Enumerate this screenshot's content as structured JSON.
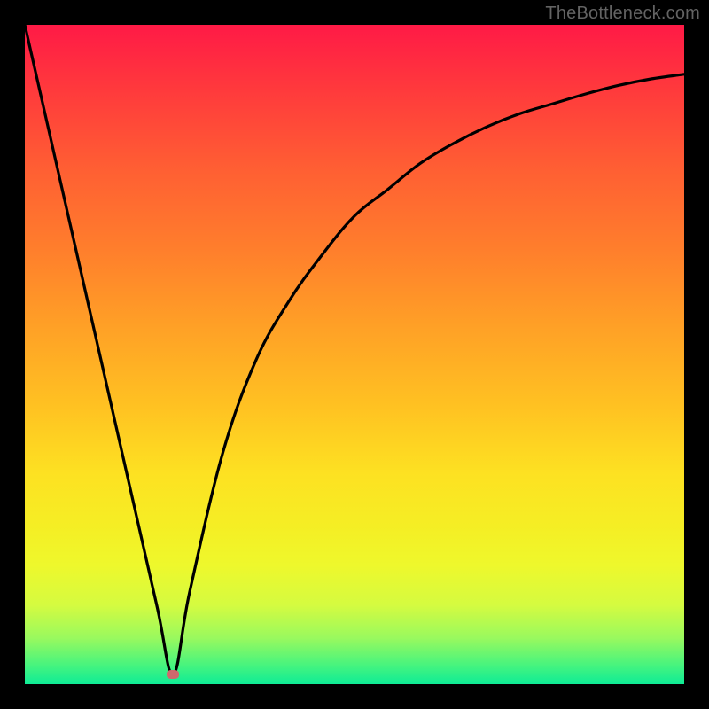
{
  "attribution": "TheBottleneck.com",
  "chart_data": {
    "type": "line",
    "title": "",
    "xlabel": "",
    "ylabel": "",
    "xlim": [
      0,
      100
    ],
    "ylim": [
      0,
      100
    ],
    "grid": false,
    "legend": false,
    "series": [
      {
        "name": "bottleneck-curve",
        "x": [
          0,
          5,
          10,
          15,
          20,
          22.5,
          25,
          30,
          35,
          40,
          45,
          50,
          55,
          60,
          65,
          70,
          75,
          80,
          85,
          90,
          95,
          100
        ],
        "y": [
          100,
          78,
          56,
          34,
          12,
          1.5,
          14,
          35,
          49,
          58,
          65,
          71,
          75,
          79,
          82,
          84.5,
          86.5,
          88,
          89.5,
          90.8,
          91.8,
          92.5
        ]
      }
    ],
    "minimum_marker": {
      "x": 22.5,
      "y": 1.5
    },
    "background_gradient": {
      "orientation": "vertical",
      "stops": [
        {
          "pos": 0.0,
          "color": "#ff1a46"
        },
        {
          "pos": 0.5,
          "color": "#ffc222"
        },
        {
          "pos": 0.8,
          "color": "#f5ee24"
        },
        {
          "pos": 1.0,
          "color": "#0eec96"
        }
      ]
    },
    "notes": "No axis ticks or numeric labels are visible; values are relative (0–100). The curve drops linearly from top-left to a minimum near x≈22 then rises with a decelerating slope toward the right edge."
  },
  "colors": {
    "curve_stroke": "#000000",
    "frame": "#000000",
    "min_marker": "#cf6a6d",
    "watermark": "#636363"
  }
}
